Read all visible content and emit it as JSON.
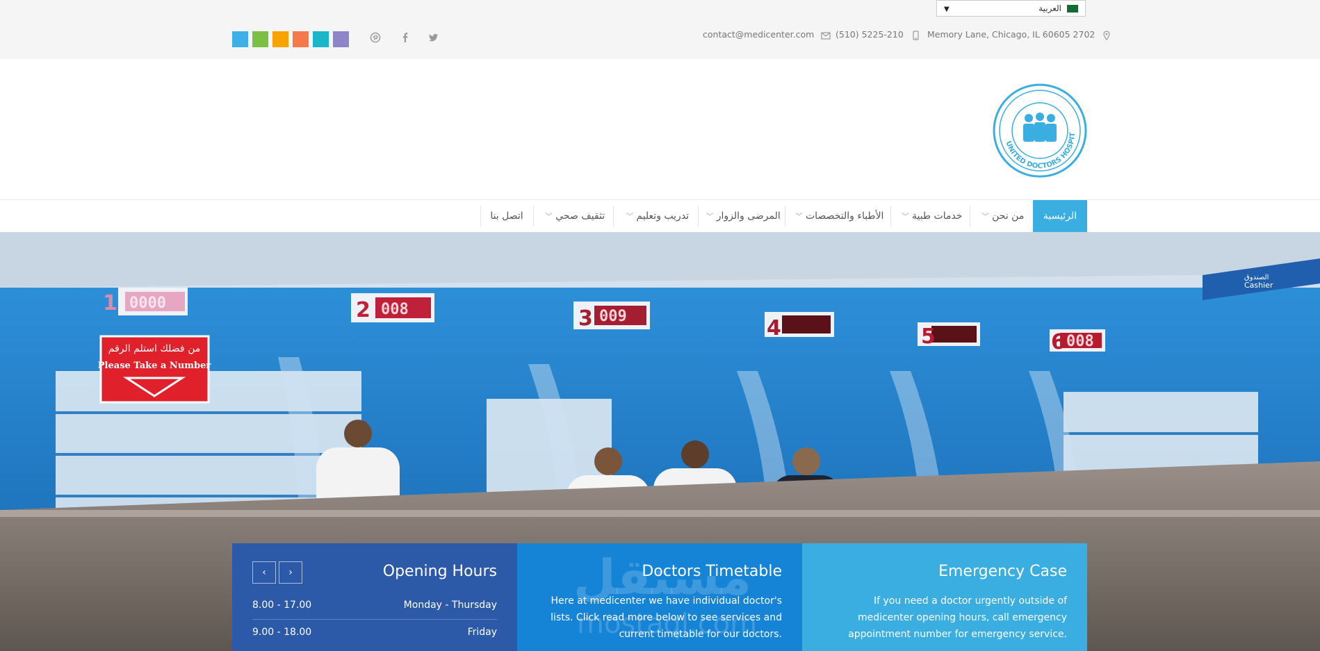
{
  "language": {
    "selected": "العربية"
  },
  "contact": {
    "address": "Memory Lane, Chicago, IL 60605 2702",
    "phone": "(510) 5225-210",
    "email": "contact@medicenter.com"
  },
  "social": {
    "twitter": "twitter-icon",
    "facebook": "facebook-icon",
    "pinterest": "pinterest-icon"
  },
  "color_swatches": [
    "#3eb0e8",
    "#7bc043",
    "#f7a300",
    "#f5794a",
    "#1ab7c9",
    "#8e84c9"
  ],
  "logo": {
    "text": "UNITED DOCTORS HOSPITAL",
    "color": "#3aaee0"
  },
  "nav": {
    "items": [
      {
        "label": "الرئيسية",
        "active": true,
        "dropdown": false
      },
      {
        "label": "من نحن",
        "active": false,
        "dropdown": true
      },
      {
        "label": "خدمات طبية",
        "active": false,
        "dropdown": true
      },
      {
        "label": "الأطباء والتخصصات",
        "active": false,
        "dropdown": true
      },
      {
        "label": "المرضى والزوار",
        "active": false,
        "dropdown": true
      },
      {
        "label": "تدريب وتعليم",
        "active": false,
        "dropdown": true
      },
      {
        "label": "تثقيف صحي",
        "active": false,
        "dropdown": true
      },
      {
        "label": "اتصل بنا",
        "active": false,
        "dropdown": false
      }
    ]
  },
  "hero": {
    "sign_text": "من فضلك استلم الرقم",
    "sign_text_en": "Please Take a Number",
    "counter_numbers": [
      "1",
      "2",
      "3",
      "4",
      "5",
      "6"
    ],
    "counter_displays": [
      "0000",
      "008",
      "009",
      "",
      "",
      "008"
    ],
    "cashier_label": "Cashier",
    "cashier_label_ar": "الصندوق"
  },
  "opening_hours": {
    "title": "Opening Hours",
    "rows": [
      {
        "day": "Monday - Thursday",
        "time": "8.00 - 17.00"
      },
      {
        "day": "Friday",
        "time": "9.00 - 18.00"
      }
    ],
    "prev": "‹",
    "next": "›"
  },
  "doctors_timetable": {
    "title": "Doctors Timetable",
    "text": "Here at medicenter we have individual doctor's lists. Click read more below to see services and current timetable for our doctors."
  },
  "emergency": {
    "title": "Emergency Case",
    "text": "If you need a doctor urgently outside of medicenter opening hours, call emergency appointment number for emergency service."
  },
  "watermark": {
    "text": "مستقل",
    "sub": "mostaql.com"
  }
}
